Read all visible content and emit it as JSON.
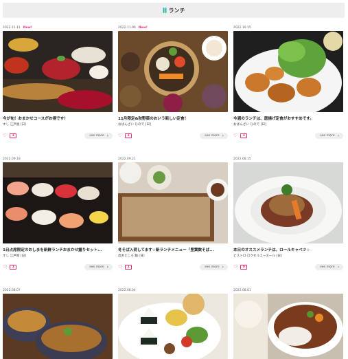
{
  "header": {
    "title": "ランチ",
    "icon": "utensils-icon",
    "icon_color": "#2fb5a5"
  },
  "accent": "#e8336d",
  "cards": [
    {
      "date": "2022.11.11",
      "new": "New!",
      "title": "今が旬！おまかせコースがお得です！",
      "shop": "すし 江戸屋 [日]",
      "likes": "3",
      "see_more": "see more"
    },
    {
      "date": "2022.11.06",
      "new": "New!",
      "title": "11月限定&秋野菜のおいう新しい定食！",
      "shop": "おばんざい ひので [日]",
      "likes": "2",
      "see_more": "see more"
    },
    {
      "date": "2022.10.15",
      "new": "",
      "title": "今週のランチは、唐揚げ定食がおすすめです。",
      "shop": "おばんざい ひので [日]",
      "likes": "3",
      "see_more": "see more"
    },
    {
      "date": "2022.09.18",
      "new": "",
      "title": "1日占席限定のおしまを新鮮ランチおまかせ握りセット...",
      "shop": "すし 江戸屋 [日]",
      "likes": "1",
      "see_more": "see more"
    },
    {
      "date": "2022.09.21",
      "new": "",
      "title": "冬そば入荷してます☆新ランチメニュー「里葉数そば...",
      "shop": "高木どころ 麺 [日]",
      "likes": "1",
      "see_more": "see more"
    },
    {
      "date": "2022.08.15",
      "new": "",
      "title": "本日のオススメランチは、ロールキャベツ☆",
      "shop": "ビストロ ロクセルコーヌール [日]",
      "likes": "0",
      "see_more": "see more"
    },
    {
      "date": "2022.08.07",
      "new": "",
      "title": "",
      "shop": "",
      "likes": "",
      "see_more": ""
    },
    {
      "date": "2022.08.04",
      "new": "",
      "title": "",
      "shop": "",
      "likes": "",
      "see_more": ""
    },
    {
      "date": "2022.08.01",
      "new": "",
      "title": "",
      "shop": "",
      "likes": "",
      "see_more": ""
    }
  ]
}
